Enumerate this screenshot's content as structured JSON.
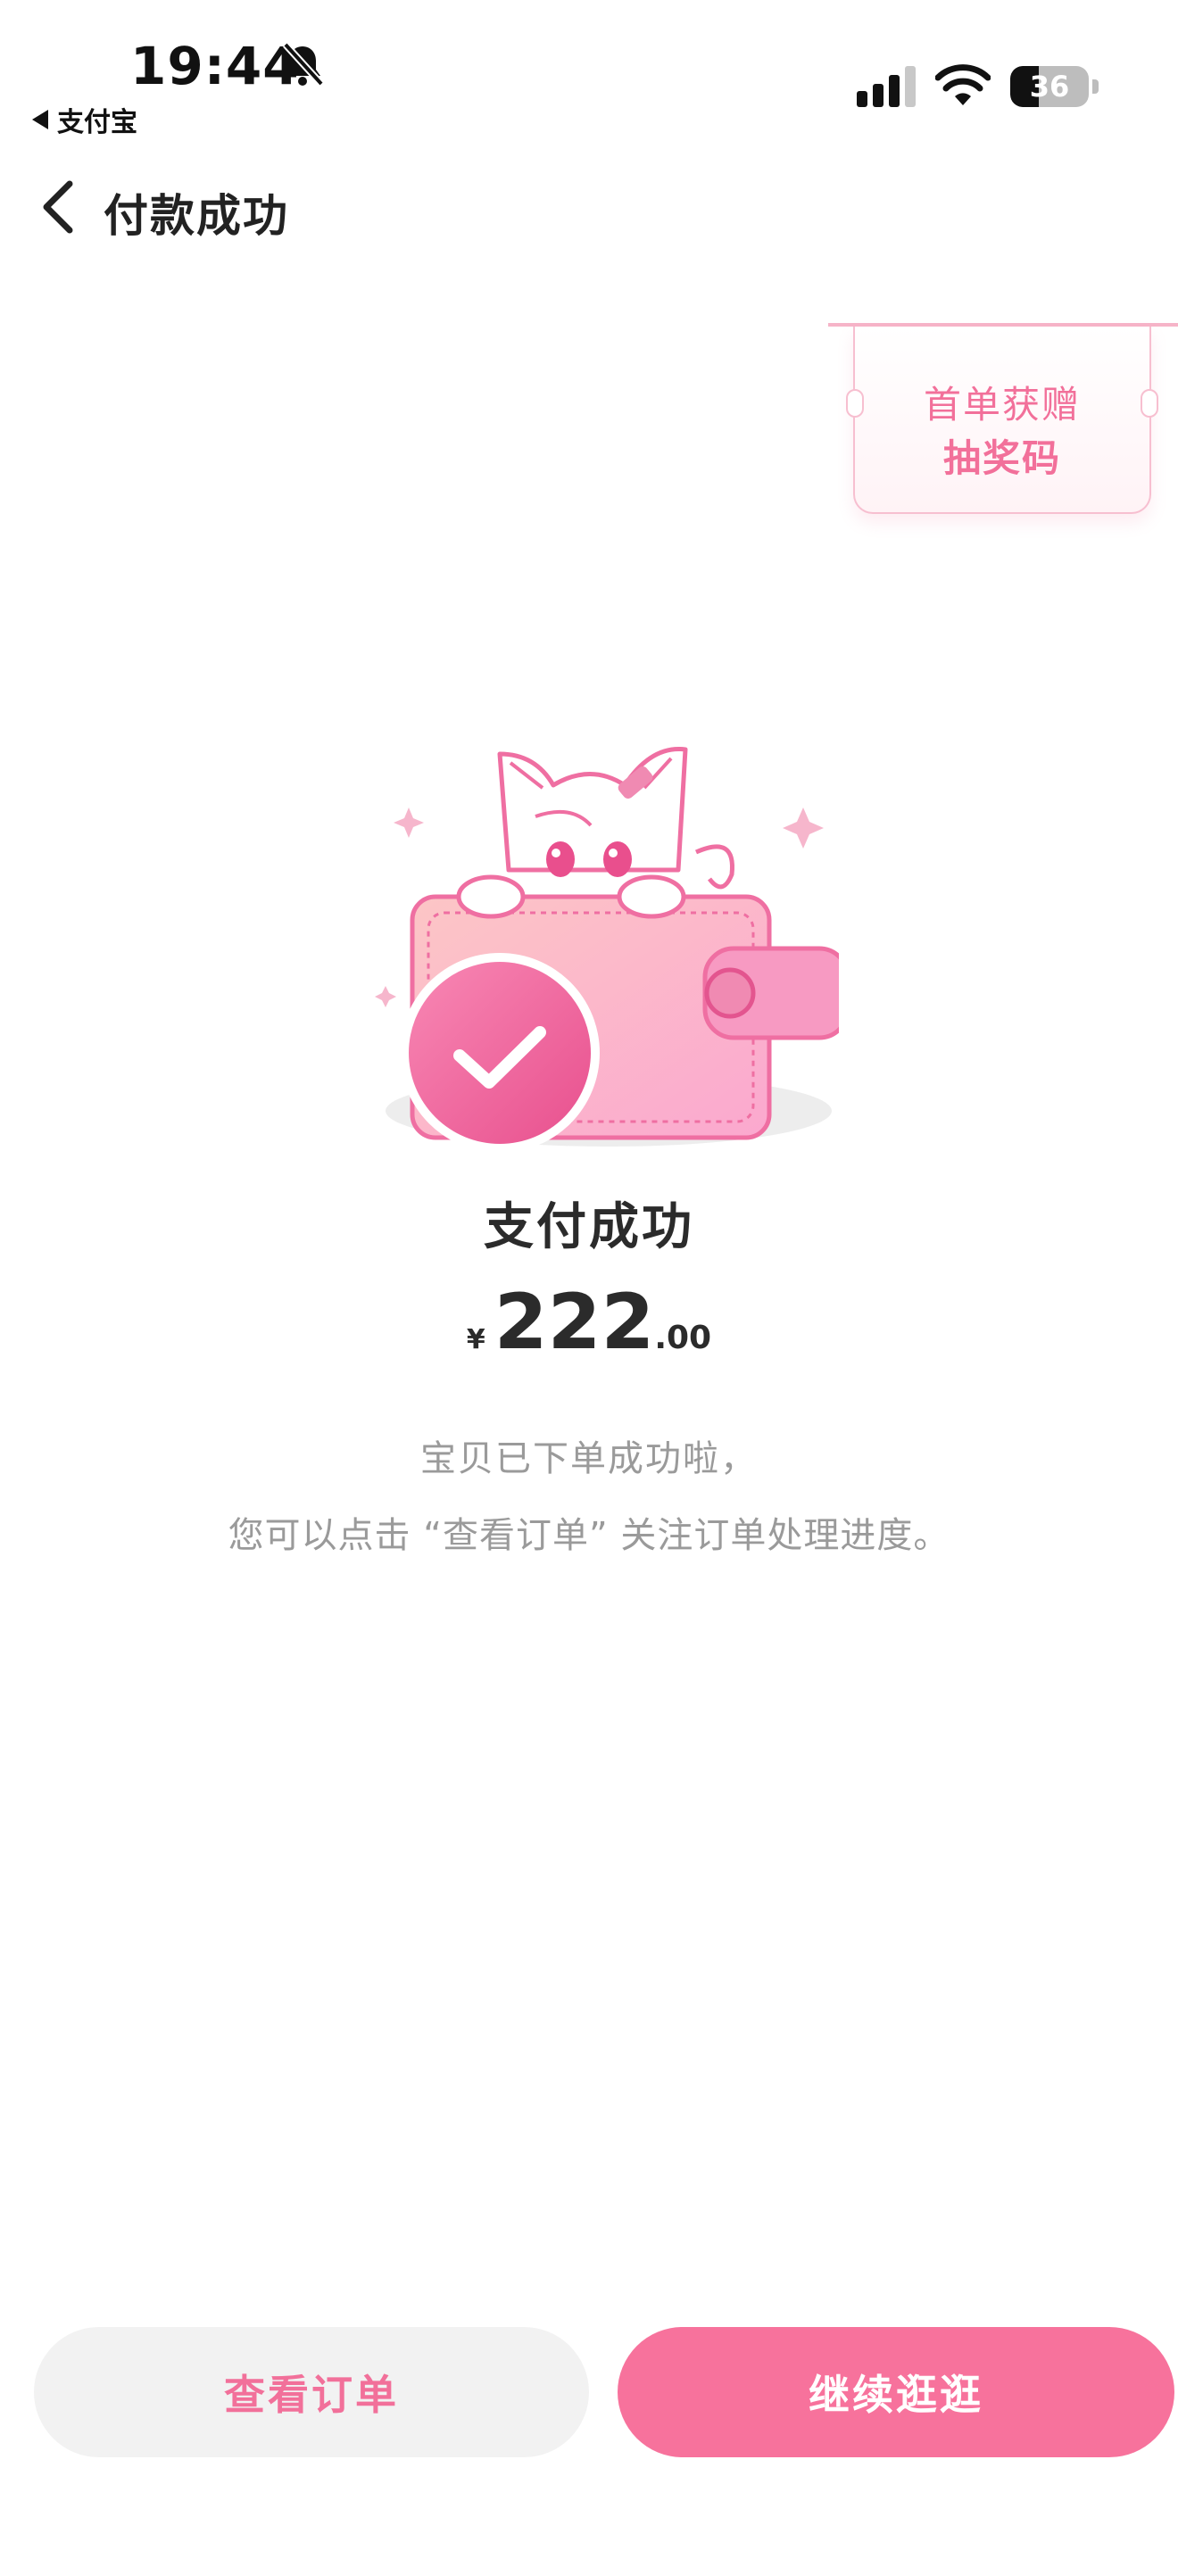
{
  "status_bar": {
    "time": "19:44",
    "back_app_label": "支付宝",
    "battery": "36",
    "battery_level": 0.36,
    "icons": [
      "bell-slash-icon",
      "signal-icon",
      "wifi-icon",
      "battery-icon"
    ]
  },
  "nav": {
    "title": "付款成功",
    "back_icon": "chevron-left-icon"
  },
  "promo": {
    "line1": "首单获赠",
    "line2": "抽奖码"
  },
  "result": {
    "title": "支付成功",
    "currency": "¥",
    "amount_int": "222",
    "amount_dec": ".00",
    "desc_line1": "宝贝已下单成功啦，",
    "desc_line2": "您可以点击 “查看订单” 关注订单处理进度。"
  },
  "buttons": {
    "view_order": "查看订单",
    "continue_shopping": "继续逛逛"
  },
  "colors": {
    "accent_pink": "#f7729c",
    "text_pink": "#f2709a",
    "muted_text": "#9a9a9a",
    "button_gray": "#f2f2f2"
  }
}
